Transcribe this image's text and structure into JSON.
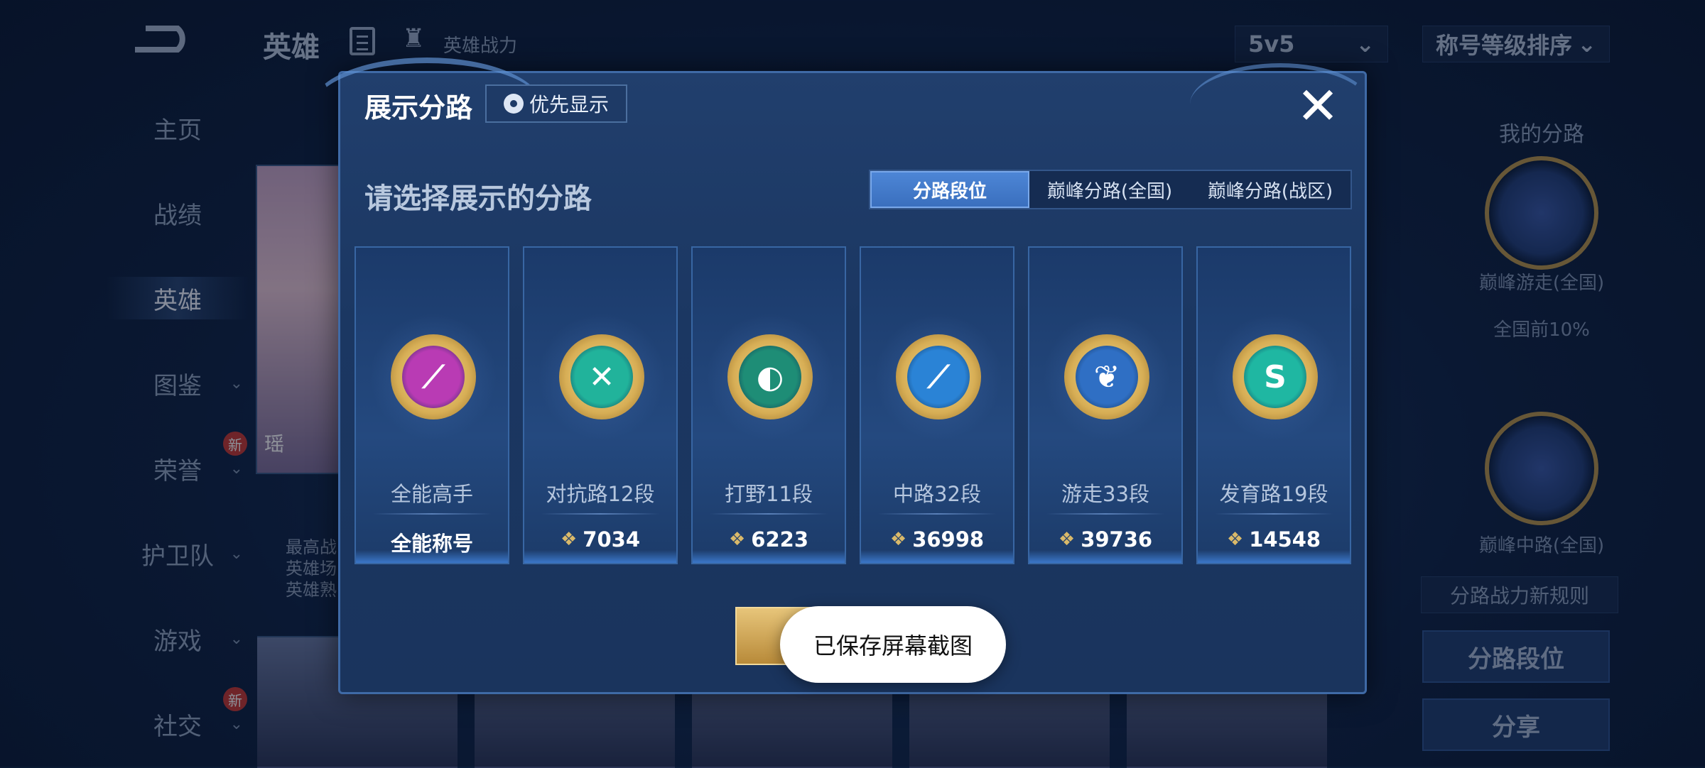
{
  "background": {
    "title": "英雄",
    "power_label": "英雄战力",
    "mode_select": "5v5",
    "sort_select": "称号等级排序",
    "sidebar": [
      {
        "label": "主页",
        "chevron": false,
        "badge": ""
      },
      {
        "label": "战绩",
        "chevron": false,
        "badge": ""
      },
      {
        "label": "英雄",
        "chevron": false,
        "badge": "",
        "active": true
      },
      {
        "label": "图鉴",
        "chevron": true,
        "badge": ""
      },
      {
        "label": "荣誉",
        "chevron": true,
        "badge": "新"
      },
      {
        "label": "护卫队",
        "chevron": true,
        "badge": ""
      },
      {
        "label": "游戏",
        "chevron": true,
        "badge": ""
      },
      {
        "label": "社交",
        "chevron": true,
        "badge": "新"
      }
    ],
    "hero_name": "瑶",
    "hero_info": [
      "最高战",
      "英雄场",
      "英雄熟"
    ],
    "right_panel": {
      "title": "我的分路",
      "lane1_label": "巅峰游走(全国)",
      "lane1_rank": "全国前10%",
      "lane2_label": "巅峰中路(全国)",
      "rule_button": "分路战力新规则",
      "lane_button": "分路段位",
      "share_button": "分享"
    }
  },
  "modal": {
    "title": "展示分路",
    "priority_button": "优先显示",
    "close": "✕",
    "subtitle": "请选择展示的分路",
    "tabs": [
      "分路段位",
      "巅峰分路(全国)",
      "巅峰分路(战区)"
    ],
    "active_tab": 0,
    "cards": [
      {
        "label": "全能高手",
        "value": "全能称号",
        "face": "#b93bb4",
        "glyph": "⟋",
        "points_icon": false
      },
      {
        "label": "对抗路12段",
        "value": "7034",
        "face": "#21b39b",
        "glyph": "✕",
        "points_icon": true
      },
      {
        "label": "打野11段",
        "value": "6223",
        "face": "#1e8d76",
        "glyph": "◐",
        "points_icon": true
      },
      {
        "label": "中路32段",
        "value": "36998",
        "face": "#2a83d6",
        "glyph": "⟋",
        "points_icon": true
      },
      {
        "label": "游走33段",
        "value": "39736",
        "face": "#2f6fc4",
        "glyph": "❦",
        "points_icon": true
      },
      {
        "label": "发育路19段",
        "value": "14548",
        "face": "#1fb7a2",
        "glyph": "S",
        "points_icon": true
      }
    ]
  },
  "toast": "已保存屏幕截图"
}
